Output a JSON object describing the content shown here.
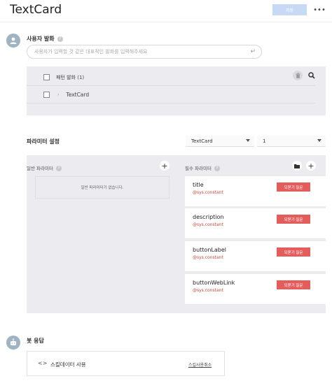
{
  "header": {
    "title": "TextCard",
    "save_label": "저장",
    "more_label": "•••"
  },
  "user_utterance": {
    "label": "사용자 발화",
    "placeholder": "사용자가 입력할 것 같은 대표적인 발화를 입력해주세요",
    "patterns_label": "패턴 발화 (1)",
    "patterns": [
      "TextCard"
    ]
  },
  "parameters": {
    "label": "파라미터 설정",
    "select_block": "TextCard",
    "select_count": "1",
    "optional_label": "일반 파라미터",
    "optional_empty": "일반 파라미터가 없습니다.",
    "required_label": "필수 파라미터",
    "required": [
      {
        "name": "title",
        "entity": "@sys.constant",
        "button": "되묻기 질문"
      },
      {
        "name": "description",
        "entity": "@sys.constant",
        "button": "되묻기 질문"
      },
      {
        "name": "buttonLabel",
        "entity": "@sys.constant",
        "button": "되묻기 질문"
      },
      {
        "name": "buttonWebLink",
        "entity": "@sys.constant",
        "button": "되묻기 질문"
      }
    ]
  },
  "bot_response": {
    "label": "봇 응답",
    "code_icon": "<>",
    "skill_label": "스킬데이터 사용",
    "cancel_label": "스킬사용취소"
  },
  "colors": {
    "accent_disabled": "#c8d9f6",
    "reply_button": "#e45d5d",
    "entity_text": "#c44a3a",
    "panel_bg": "#ebebf0"
  }
}
